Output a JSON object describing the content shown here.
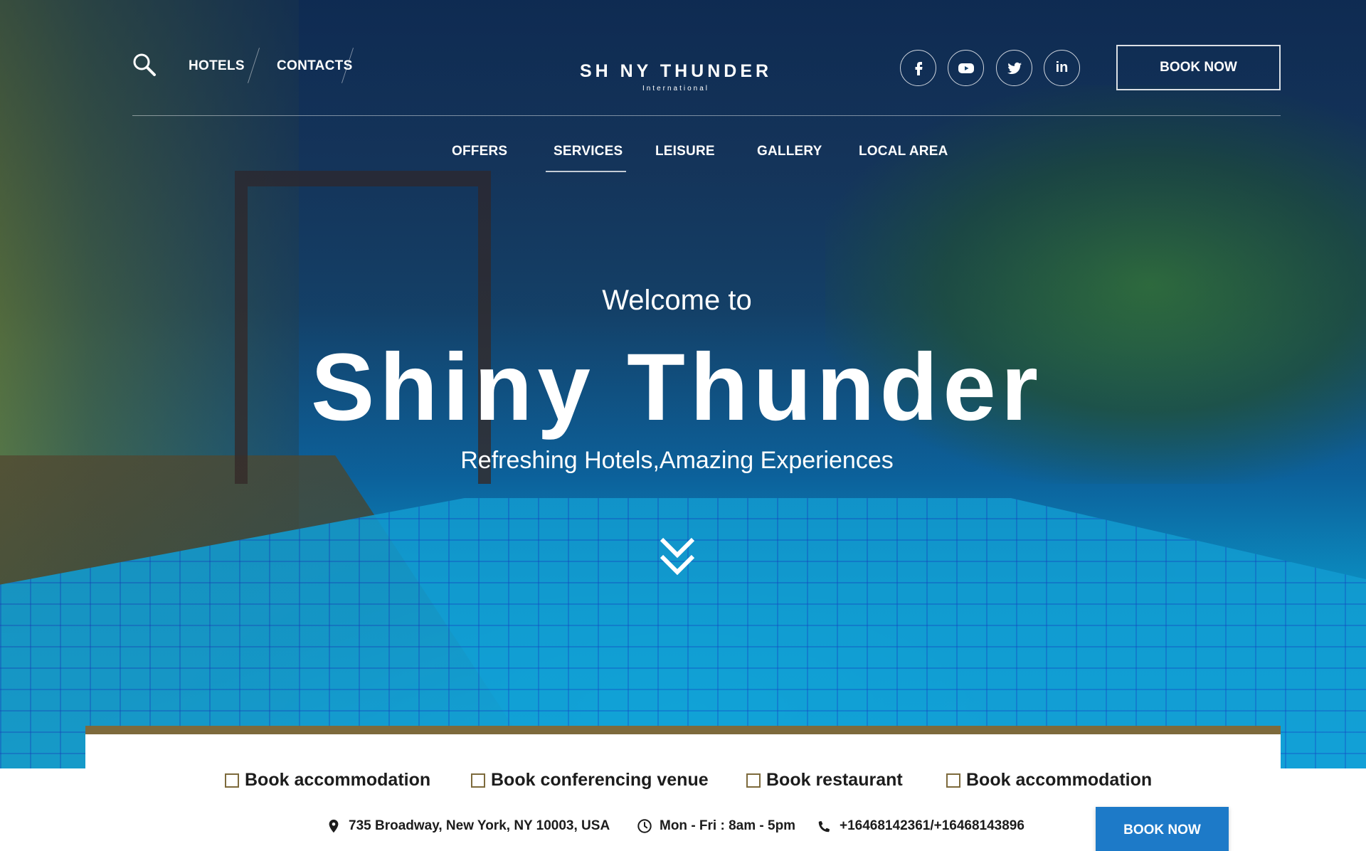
{
  "header": {
    "search_icon": "search-icon",
    "links": [
      "HOTELS",
      "CONTACTS"
    ],
    "logo": {
      "title": "SH NY THUNDER",
      "subtitle": "International"
    },
    "social": [
      {
        "icon": "facebook-icon"
      },
      {
        "icon": "youtube-icon"
      },
      {
        "icon": "twitter-icon"
      },
      {
        "icon": "linkedin-icon",
        "glyph": "in"
      }
    ],
    "book_now": "BOOK NOW"
  },
  "main_nav": {
    "items": [
      "OFFERS",
      "SERVICES",
      "LEISURE",
      "GALLERY",
      "LOCAL AREA"
    ],
    "active": "SERVICES"
  },
  "hero": {
    "welcome": "Welcome to",
    "headline": "Shiny Thunder",
    "tagline": "Refreshing Hotels,Amazing Experiences",
    "scroll_icon": "double-chevron-down-icon"
  },
  "booking": {
    "options": [
      "Book accommodation",
      "Book conferencing venue",
      "Book restaurant",
      "Book accommodation"
    ],
    "address": "735 Broadway, New York, NY 10003, USA",
    "hours": "Mon - Fri : 8am - 5pm",
    "phone": "+16468142361/+16468143896",
    "book_now": "BOOK NOW"
  },
  "colors": {
    "accent_gold": "#7d6a3c",
    "button_blue": "#1d7ac8",
    "hero_dark": "#14365c",
    "pool_blue": "#13a8de"
  }
}
